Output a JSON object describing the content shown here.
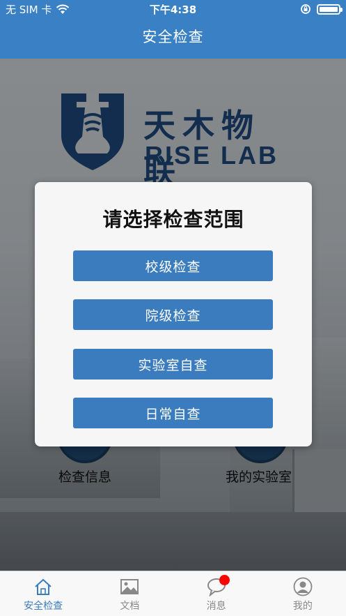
{
  "status_bar": {
    "carrier": "无 SIM 卡",
    "time": "下午4:38"
  },
  "header": {
    "title": "安全检查"
  },
  "background": {
    "brand_cn": "天木物联",
    "brand_en": "RISE LAB",
    "shortcut_left": "检查信息",
    "shortcut_right": "我的实验室"
  },
  "dialog": {
    "title": "请选择检查范围",
    "options": [
      "校级检查",
      "院级检查",
      "实验室自查",
      "日常自查"
    ]
  },
  "tabbar": {
    "items": [
      {
        "label": "安全检查",
        "icon": "home-icon",
        "active": true
      },
      {
        "label": "文档",
        "icon": "image-icon",
        "active": false
      },
      {
        "label": "消息",
        "icon": "chat-bubble-icon",
        "active": false,
        "badge": true
      },
      {
        "label": "我的",
        "icon": "user-icon",
        "active": false
      }
    ]
  },
  "colors": {
    "primary": "#3a80c4",
    "button": "#3a7cbd",
    "brand": "#1f4f86",
    "badge": "#ff0000"
  }
}
